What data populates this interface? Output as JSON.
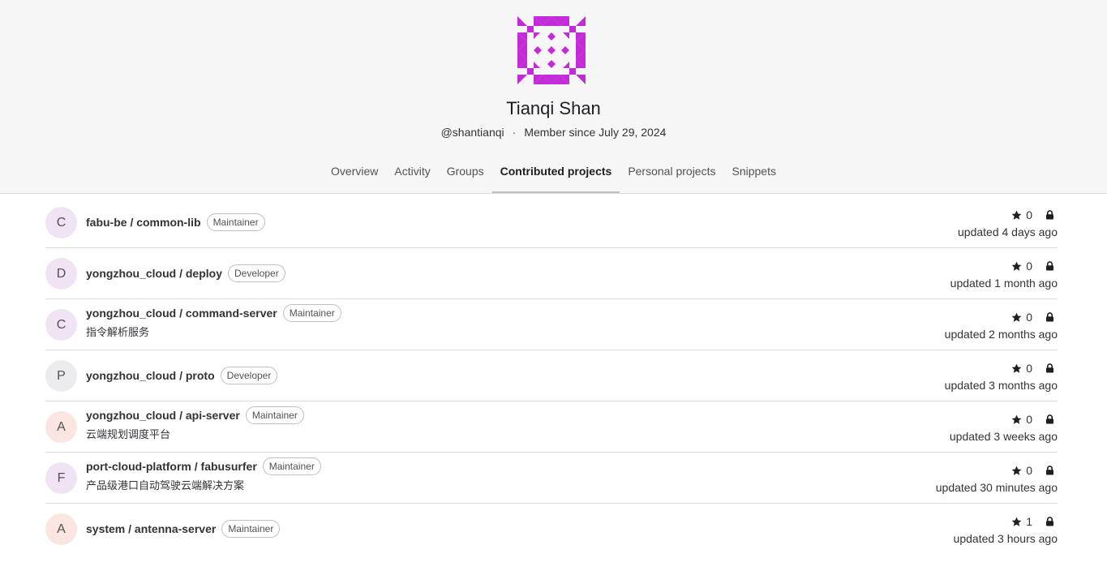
{
  "user": {
    "name": "Tianqi Shan",
    "handle": "@shantianqi",
    "separator": "·",
    "member_since": "Member since July 29, 2024",
    "avatar_color": "#c42bd8"
  },
  "tabs": [
    {
      "label": "Overview",
      "active": false
    },
    {
      "label": "Activity",
      "active": false
    },
    {
      "label": "Groups",
      "active": false
    },
    {
      "label": "Contributed projects",
      "active": true
    },
    {
      "label": "Personal projects",
      "active": false
    },
    {
      "label": "Snippets",
      "active": false
    }
  ],
  "projects": [
    {
      "letter": "C",
      "name": "fabu-be / common-lib",
      "role": "Maintainer",
      "description": "",
      "stars": "0",
      "updated": "updated 4 days ago",
      "avatar_bg": "#f0e3f4"
    },
    {
      "letter": "D",
      "name": "yongzhou_cloud / deploy",
      "role": "Developer",
      "description": "",
      "stars": "0",
      "updated": "updated 1 month ago",
      "avatar_bg": "#f0e3f4"
    },
    {
      "letter": "C",
      "name": "yongzhou_cloud / command-server",
      "role": "Maintainer",
      "description": "指令解析服务",
      "stars": "0",
      "updated": "updated 2 months ago",
      "avatar_bg": "#f0e3f4"
    },
    {
      "letter": "P",
      "name": "yongzhou_cloud / proto",
      "role": "Developer",
      "description": "",
      "stars": "0",
      "updated": "updated 3 months ago",
      "avatar_bg": "#ececef"
    },
    {
      "letter": "A",
      "name": "yongzhou_cloud / api-server",
      "role": "Maintainer",
      "description": "云端规划调度平台",
      "stars": "0",
      "updated": "updated 3 weeks ago",
      "avatar_bg": "#fbe5e1"
    },
    {
      "letter": "F",
      "name": "port-cloud-platform / fabusurfer",
      "role": "Maintainer",
      "description": "产品级港口自动驾驶云端解决方案",
      "stars": "0",
      "updated": "updated 30 minutes ago",
      "avatar_bg": "#f0e3f4"
    },
    {
      "letter": "A",
      "name": "system / antenna-server",
      "role": "Maintainer",
      "description": "",
      "stars": "1",
      "updated": "updated 3 hours ago",
      "avatar_bg": "#fbe5e1"
    }
  ]
}
